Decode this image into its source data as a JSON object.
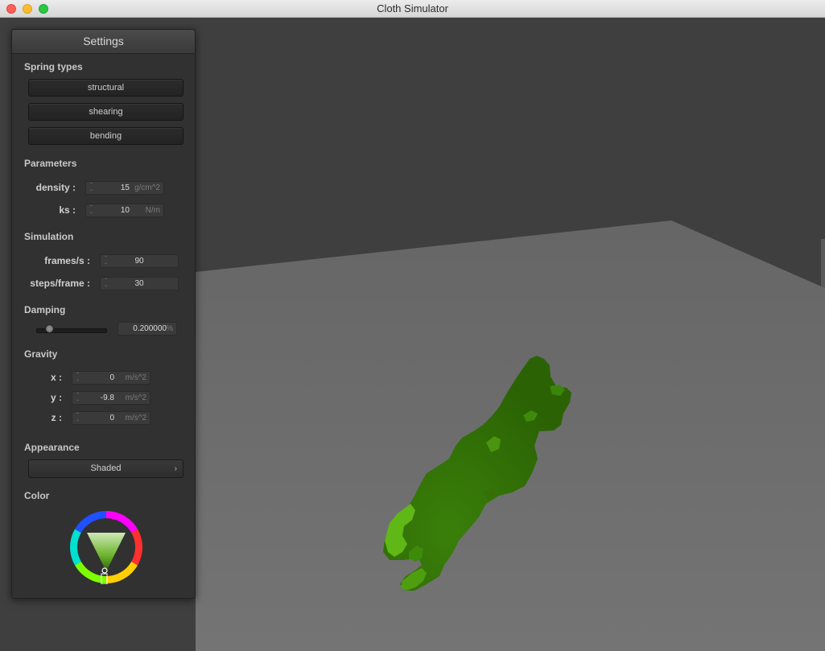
{
  "window": {
    "title": "Cloth Simulator"
  },
  "panel": {
    "title": "Settings",
    "spring_types": {
      "heading": "Spring types",
      "buttons": [
        "structural",
        "shearing",
        "bending"
      ]
    },
    "parameters": {
      "heading": "Parameters",
      "density": {
        "label": "density :",
        "value": "15",
        "unit": "g/cm^2"
      },
      "ks": {
        "label": "ks :",
        "value": "10",
        "unit": "N/m"
      }
    },
    "simulation": {
      "heading": "Simulation",
      "fps": {
        "label": "frames/s :",
        "value": "90"
      },
      "steps": {
        "label": "steps/frame :",
        "value": "30"
      }
    },
    "damping": {
      "heading": "Damping",
      "value": "0.200000",
      "unit": "%",
      "slider_fraction": 0.2
    },
    "gravity": {
      "heading": "Gravity",
      "x": {
        "label": "x :",
        "value": "0",
        "unit": "m/s^2"
      },
      "y": {
        "label": "y :",
        "value": "-9.8",
        "unit": "m/s^2"
      },
      "z": {
        "label": "z :",
        "value": "0",
        "unit": "m/s^2"
      }
    },
    "appearance": {
      "heading": "Appearance",
      "selected": "Shaded"
    },
    "color": {
      "heading": "Color",
      "selected_color": "#5fbf1f"
    }
  },
  "scene": {
    "background_color": "#3f3f3f",
    "plane_color": "#6e6e6e",
    "cloth_color": "#2e6a05",
    "cloth_highlight_color": "#6cc21a"
  }
}
